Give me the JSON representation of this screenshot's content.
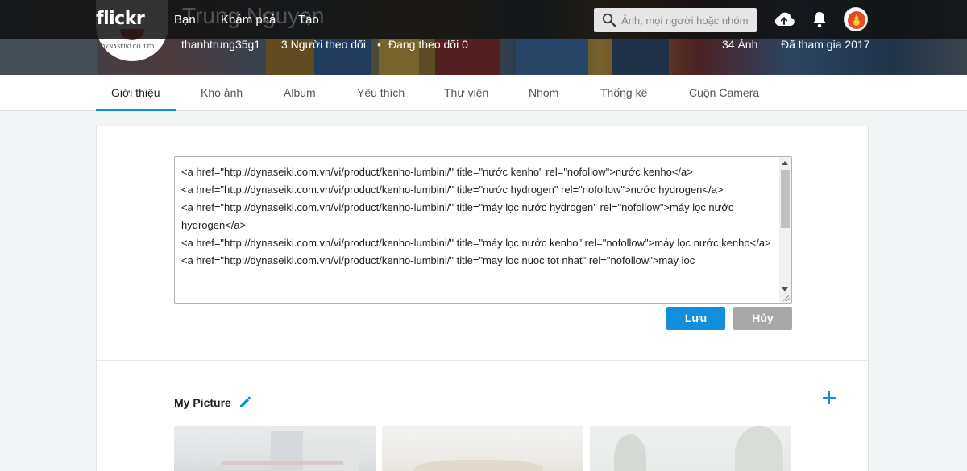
{
  "header": {
    "logo": "flickr",
    "nav": [
      "Bạn",
      "Khám phá",
      "Tạo"
    ],
    "search_placeholder": "Ảnh, mọi người hoặc nhóm",
    "icons": [
      "upload-icon",
      "bell-icon",
      "avatar"
    ]
  },
  "profile": {
    "avatar_caption": "DYNASEIKI CO.,LTD",
    "name_overlay": "Trung Nguyen",
    "username": "thanhtrung35g1",
    "followers": "3 Người theo dõi",
    "separator": "•",
    "following": "Đang theo dõi 0",
    "photos": "34 Ảnh",
    "joined": "Đã tham gia 2017"
  },
  "tabs": [
    {
      "label": "Giới thiệu",
      "active": true
    },
    {
      "label": "Kho ảnh"
    },
    {
      "label": "Album"
    },
    {
      "label": "Yêu thích"
    },
    {
      "label": "Thư viện"
    },
    {
      "label": "Nhóm"
    },
    {
      "label": "Thống kê"
    },
    {
      "label": "Cuộn Camera"
    }
  ],
  "editor": {
    "text": "<a href=\"http://dynaseiki.com.vn/vi/product/kenho-lumbini/\" title=\"nước kenho\" rel=\"nofollow\">nước kenho</a>\n<a href=\"http://dynaseiki.com.vn/vi/product/kenho-lumbini/\" title=\"nước hydrogen\" rel=\"nofollow\">nước hydrogen</a>\n<a href=\"http://dynaseiki.com.vn/vi/product/kenho-lumbini/\" title=\"máy lọc nước hydrogen\" rel=\"nofollow\">máy lọc nước hydrogen</a>\n<a href=\"http://dynaseiki.com.vn/vi/product/kenho-lumbini/\" title=\"máy lọc nước kenho\" rel=\"nofollow\">máy lọc nước kenho</a>\n<a href=\"http://dynaseiki.com.vn/vi/product/kenho-lumbini/\" title=\"may loc nuoc tot nhat\" rel=\"nofollow\">may loc",
    "save_label": "Lưu",
    "cancel_label": "Hủy"
  },
  "showcase": {
    "title": "My Picture"
  },
  "colors": {
    "accent": "#128fdc",
    "cancel": "#a8a8a8",
    "topbar": "#121212"
  }
}
